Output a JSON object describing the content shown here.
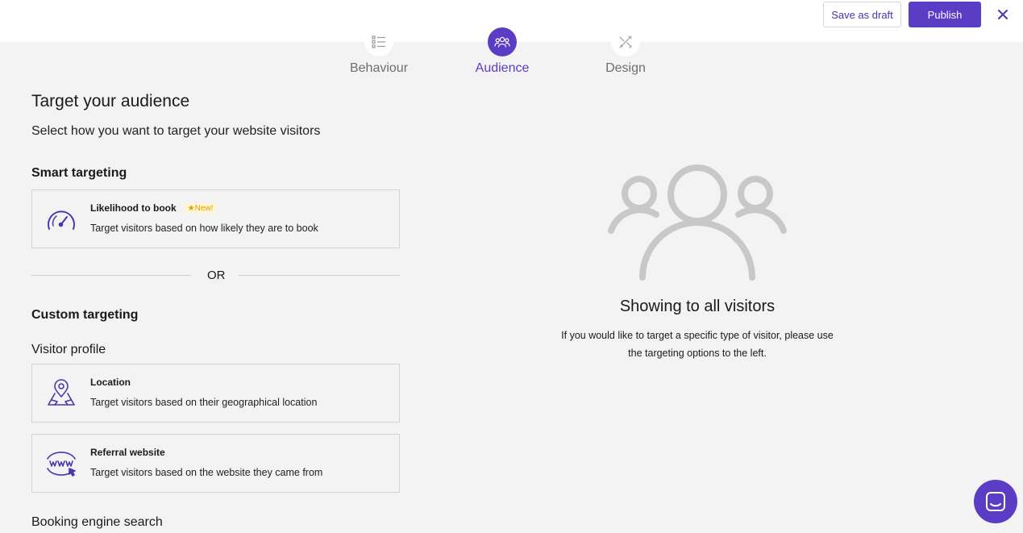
{
  "header": {
    "save_draft_label": "Save as draft",
    "publish_label": "Publish"
  },
  "steps": [
    {
      "label": "Behaviour",
      "icon": "checklist-icon",
      "active": false
    },
    {
      "label": "Audience",
      "icon": "users-icon",
      "active": true
    },
    {
      "label": "Design",
      "icon": "design-tools-icon",
      "active": false
    }
  ],
  "main": {
    "title": "Target your audience",
    "subtitle": "Select how you want to target your website visitors",
    "smart_title": "Smart targeting",
    "likelihood": {
      "title": "Likelihood to book",
      "badge": "New!",
      "desc": "Target visitors based on how likely they are to book"
    },
    "or_label": "OR",
    "custom_title": "Custom targeting",
    "visitor_profile_title": "Visitor profile",
    "location": {
      "title": "Location",
      "desc": "Target visitors based on their geographical location"
    },
    "referral": {
      "title": "Referral website",
      "desc": "Target visitors based on the website they came from"
    },
    "booking_engine_title": "Booking engine search"
  },
  "empty_state": {
    "title": "Showing to all visitors",
    "text": "If you would like to target a specific type of visitor, please use the targeting options to the left."
  },
  "colors": {
    "accent": "#5b3cc4",
    "background": "#f3f3f3",
    "badge": "#e0a000"
  }
}
